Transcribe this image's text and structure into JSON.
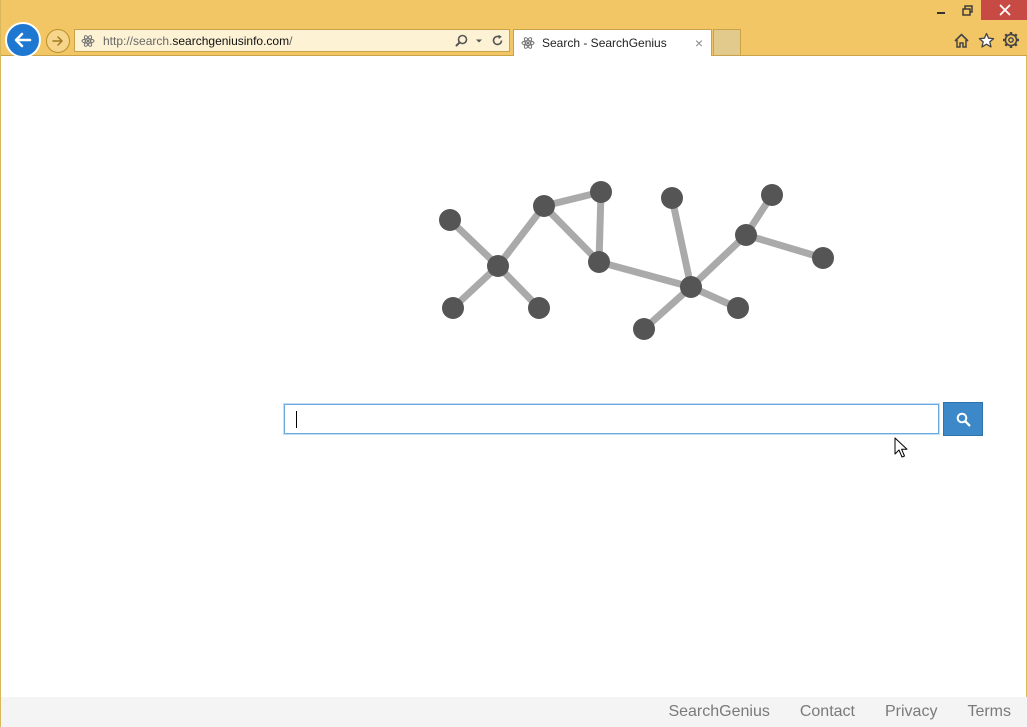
{
  "browser": {
    "url_prefix": "http://search.",
    "url_domain": "searchgeniusinfo.com",
    "url_suffix": "/",
    "tab_title": "Search - SearchGenius",
    "tab_close_glyph": "×",
    "icons": {
      "back": "back-arrow-icon",
      "forward": "forward-arrow-icon",
      "search": "search-icon",
      "dropdown": "chevron-down-icon",
      "refresh": "refresh-icon",
      "home": "home-icon",
      "favorites": "star-icon",
      "settings": "gear-icon",
      "minimize": "minimize-icon",
      "restore": "restore-icon",
      "close": "close-icon"
    },
    "colors": {
      "chrome": "#f2c665",
      "back_button": "#1e78d1",
      "close_button": "#c84a44"
    }
  },
  "page": {
    "search_placeholder": "",
    "search_value": "",
    "search_button_icon": "search-icon",
    "logo": "molecule-logo",
    "colors": {
      "node": "#555555",
      "edge": "#aaaaaa",
      "search_button": "#3d88c9"
    }
  },
  "footer": {
    "links": [
      "SearchGenius",
      "Contact",
      "Privacy",
      "Terms"
    ]
  }
}
